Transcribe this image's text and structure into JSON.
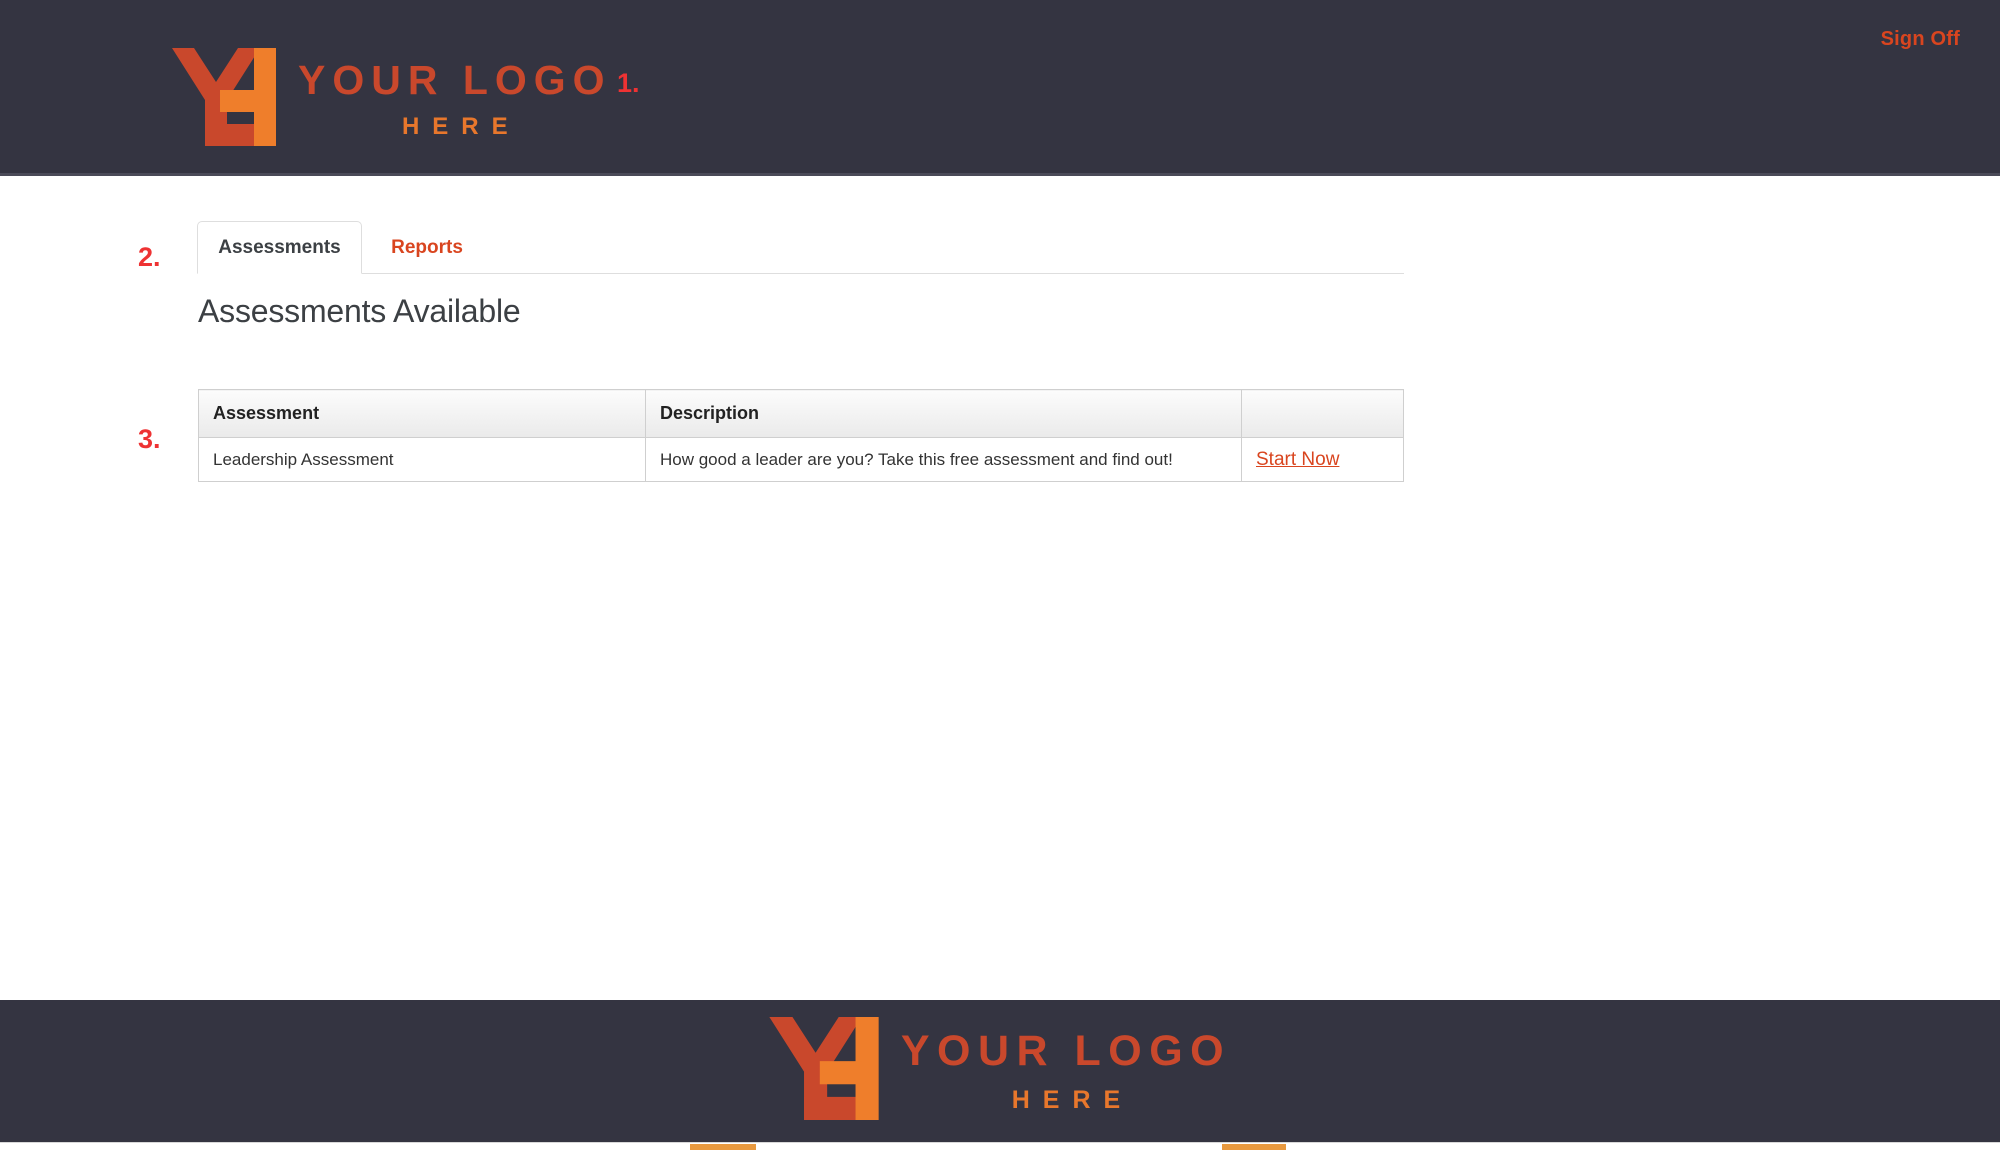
{
  "header": {
    "logo": {
      "mark_icon": "yh-monogram-logo",
      "line1": "YOUR LOGO",
      "line2": "HERE",
      "mark_color_dark": "#c9482c",
      "mark_color_light": "#e8772c"
    },
    "signoff_label": "Sign Off",
    "background": "#343441",
    "accent": "#d9451f"
  },
  "annotations": {
    "marker1": "1.",
    "marker2": "2.",
    "marker3": "3.",
    "color": "#ee3233"
  },
  "main": {
    "tabs": [
      {
        "label": "Assessments",
        "active": true
      },
      {
        "label": "Reports",
        "active": false
      }
    ],
    "page_title": "Assessments Available",
    "table": {
      "columns": [
        "Assessment",
        "Description",
        ""
      ],
      "rows": [
        {
          "assessment": "Leadership Assessment",
          "description": "How good a leader are you? Take this free assessment and find out!",
          "action_label": "Start Now"
        }
      ]
    }
  },
  "footer": {
    "logo": {
      "mark_icon": "yh-monogram-logo",
      "line1": "YOUR LOGO",
      "line2": "HERE"
    },
    "background": "#343441"
  }
}
